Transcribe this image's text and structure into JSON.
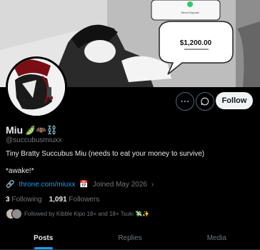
{
  "banner": {
    "price_text": "$1,200.00",
    "bubble_caption": "Direct Deposit"
  },
  "profile": {
    "name": "Miu",
    "name_emojis": "🫛🦇⛓️",
    "handle": "@succubusmiuxx",
    "bio": "Tiny Bratty Succubus Miu (needs to eat your money to survive)",
    "bio_line2": "*awake!*",
    "link": "throne.com/miuxx",
    "joined": "Joined May 2026",
    "following_count": "3",
    "following_label": "Following",
    "followers_count": "1,091",
    "followers_label": "Followers",
    "followed_by": "Followed by Kibble Kipo 18+ and 18+ Tsuki 💸✨"
  },
  "actions": {
    "more_icon": "more-icon",
    "message_icon": "message-icon",
    "follow_label": "Follow"
  },
  "tabs": [
    "Posts",
    "Replies",
    "Media"
  ],
  "colors": {
    "accent": "#1d9bf0",
    "background": "#000000",
    "text": "#e7e9ea",
    "muted": "#71767b"
  }
}
